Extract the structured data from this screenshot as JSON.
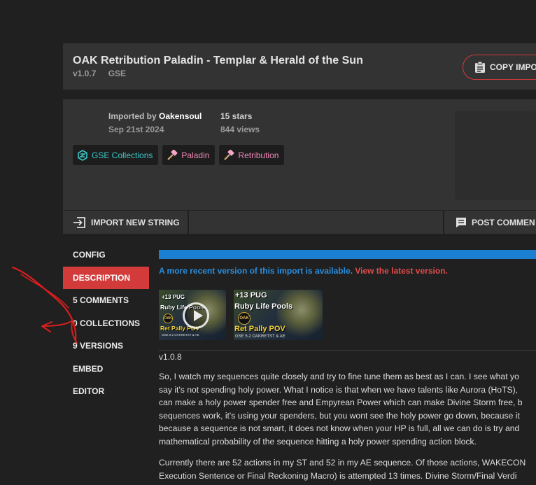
{
  "header": {
    "title": "OAK Retribution Paladin - Templar & Herald of the Sun",
    "version": "v1.0.7",
    "addon": "GSE",
    "copy_button": "COPY IMPO"
  },
  "info": {
    "imported_by_label": "Imported by ",
    "author": "Oakensoul",
    "date": "Sep 21st 2024",
    "stars": "15 stars",
    "views": "844 views",
    "tags": [
      {
        "label": "GSE Collections",
        "icon": "gse-icon"
      },
      {
        "label": "Paladin",
        "icon": "hammer-icon"
      },
      {
        "label": "Retribution",
        "icon": "hammer-icon"
      }
    ]
  },
  "actions": {
    "import_new": "IMPORT NEW STRING",
    "post_comment": "POST COMMEN"
  },
  "nav": {
    "items": [
      {
        "label": "CONFIG"
      },
      {
        "label": "DESCRIPTION"
      },
      {
        "label": "5 COMMENTS"
      },
      {
        "label": "0 COLLECTIONS"
      },
      {
        "label": "9 VERSIONS"
      },
      {
        "label": "EMBED"
      },
      {
        "label": "EDITOR"
      }
    ],
    "active_index": 1
  },
  "content": {
    "notice_text": "A more recent version of this import is available.",
    "notice_link": "View the latest version.",
    "videos": [
      {
        "line1": "+13 PUG",
        "line2": "Ruby Life Pools",
        "line3": "Ret Pally POV",
        "line4": "GSE 5.2 OAKRETST & AE",
        "oak": "OAK"
      },
      {
        "line1": "+13 PUG",
        "line2": "Ruby Life Pools",
        "line3": "Ret Pally POV",
        "line4": "GSE 5.2 OAKRETST & AE",
        "oak": "OAK"
      }
    ],
    "version_tag": "v1.0.8",
    "paragraph1": [
      "So, I watch my sequences quite closely and try to fine tune them as best as I can. I see what yo",
      "say it's not spending holy power. What I notice is that when we have talents like Aurora (HoTS),",
      "can make a holy power spender free and Empyrean Power which can make Divine Storm free, b",
      "sequences work, it's using your spenders, but you wont see the holy power go down, because it",
      "because a sequence is not smart, it does not know when your HP is full, all we can do is try and",
      "mathematical probability of the sequence hitting a holy power spending action block."
    ],
    "paragraph2": [
      "Currently there are 52 actions in my ST and 52 in my AE sequence. Of those actions, WAKECON",
      "Execution Sentence or Final Reckoning Macro) is attempted 13 times. Divine Storm/Final Verdi"
    ]
  },
  "colors": {
    "accent_red": "#d33a3a",
    "progress_blue": "#1a7fd0",
    "link_blue": "#2a8fe0",
    "gse_teal": "#3cc8c8",
    "paladin_pink": "#ee88b6"
  }
}
